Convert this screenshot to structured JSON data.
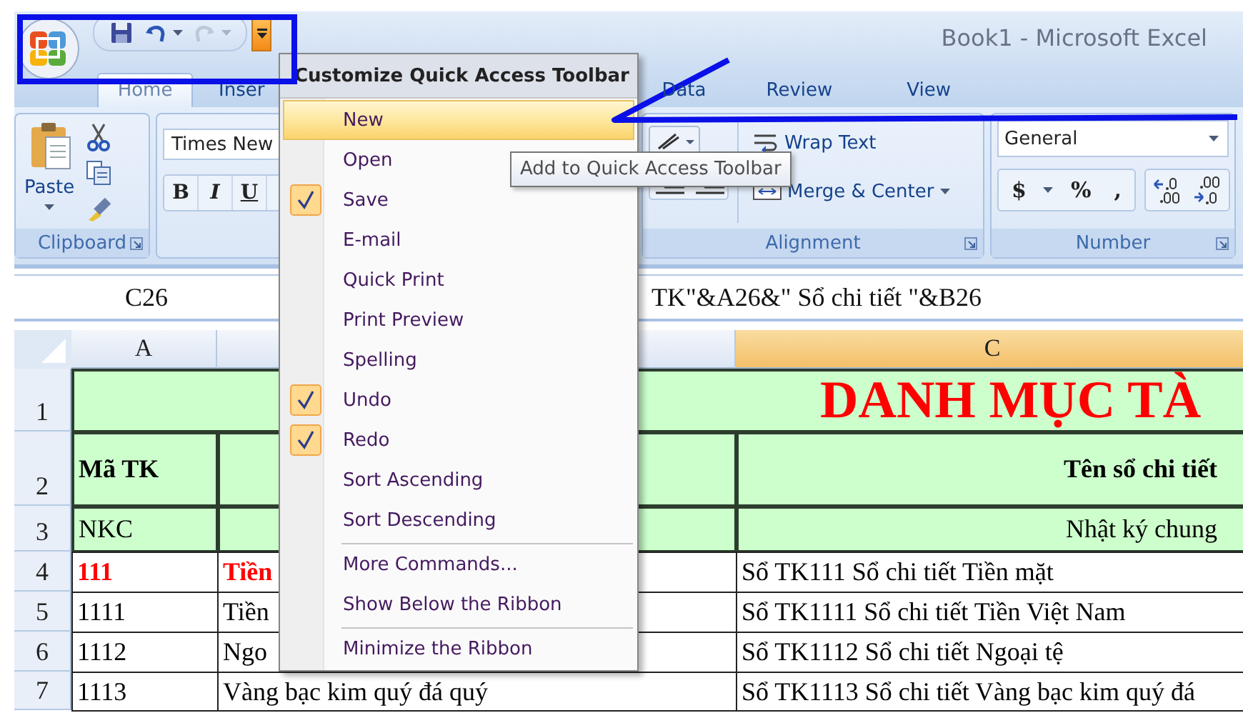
{
  "window": {
    "title": "Book1 - Microsoft Excel"
  },
  "quick_access": [
    {
      "kind": "save",
      "disabled": false
    },
    {
      "kind": "undo",
      "disabled": false
    },
    {
      "kind": "redo",
      "disabled": true
    }
  ],
  "tabs": [
    {
      "label": "Home",
      "selected": true
    },
    {
      "label": "Inser",
      "selected": false
    },
    {
      "label": "Data",
      "selected": false
    },
    {
      "label": "Review",
      "selected": false
    },
    {
      "label": "View",
      "selected": false
    }
  ],
  "ribbon": {
    "groups": [
      {
        "kind": "clipboard",
        "label": "Clipboard",
        "paste_label": "Paste"
      },
      {
        "kind": "font",
        "font_name": "Times New",
        "buttons": [
          "B",
          "I",
          "U"
        ]
      },
      {
        "kind": "alignment",
        "label": "Alignment",
        "wrap_label": "Wrap Text",
        "merge_label": "Merge & Center"
      },
      {
        "kind": "number",
        "label": "Number",
        "format": "General",
        "buttons": [
          "$",
          "%",
          ","
        ]
      }
    ]
  },
  "formula_bar": {
    "name_box": "C26",
    "formula": "TK\"&A26&\" Sổ chi tiết \"&B26"
  },
  "sheet": {
    "columns": [
      {
        "label": "A",
        "selected": false
      },
      {
        "selected": false
      },
      {
        "label": "C",
        "selected": true
      }
    ],
    "rows": [
      {
        "number": "1",
        "highlighted": true,
        "title": "DANH MỤC TÀ"
      },
      {
        "number": "2",
        "highlighted": true,
        "cells": [
          {
            "text": "Mã TK",
            "bold": true,
            "color": "#000000"
          },
          {},
          {
            "text": "Tên sổ chi tiết",
            "bold": true,
            "color": "#000000"
          }
        ]
      },
      {
        "number": "3",
        "highlighted": true,
        "cells": [
          {
            "text": "NKC",
            "bold": false,
            "color": "#000000"
          },
          {},
          {
            "text": "Nhật ký chung",
            "bold": false,
            "color": "#000000"
          }
        ]
      },
      {
        "number": "4",
        "highlighted": false,
        "cells": [
          {
            "text": "111",
            "bold": true,
            "color": "#ff0000"
          },
          {
            "text": "Tiền",
            "bold": true,
            "color": "#ff0000"
          },
          {
            "text": "Sổ TK111 Sổ chi tiết Tiền mặt",
            "bold": false,
            "color": "#000000"
          }
        ]
      },
      {
        "number": "5",
        "highlighted": false,
        "cells": [
          {
            "text": "1111",
            "bold": false,
            "color": "#000000"
          },
          {
            "text": "Tiền",
            "bold": false,
            "color": "#000000"
          },
          {
            "text": "Sổ TK1111 Sổ chi tiết Tiền Việt Nam",
            "bold": false,
            "color": "#000000"
          }
        ]
      },
      {
        "number": "6",
        "highlighted": false,
        "cells": [
          {
            "text": "1112",
            "bold": false,
            "color": "#000000"
          },
          {
            "text": "Ngo",
            "bold": false,
            "color": "#000000"
          },
          {
            "text": "Sổ TK1112 Sổ chi tiết Ngoại tệ",
            "bold": false,
            "color": "#000000"
          }
        ]
      },
      {
        "number": "7",
        "highlighted": false,
        "cells": [
          {
            "text": "1113",
            "bold": false,
            "color": "#000000"
          },
          {
            "text": "Vàng bạc kim quý đá quý",
            "bold": false,
            "color": "#000000"
          },
          {
            "text": "Sổ TK1113 Sổ chi tiết Vàng bạc kim quý đá",
            "bold": false,
            "color": "#000000"
          }
        ]
      }
    ]
  },
  "menu": {
    "title": "Customize Quick Access Toolbar",
    "items": [
      {
        "label": "New",
        "checked": false,
        "selected": true
      },
      {
        "label": "Open",
        "checked": false,
        "selected": false
      },
      {
        "label": "Save",
        "checked": true,
        "selected": false
      },
      {
        "label": "E-mail",
        "checked": false,
        "selected": false
      },
      {
        "label": "Quick Print",
        "checked": false,
        "selected": false
      },
      {
        "label": "Print Preview",
        "checked": false,
        "selected": false
      },
      {
        "label": "Spelling",
        "checked": false,
        "selected": false
      },
      {
        "label": "Undo",
        "checked": true,
        "selected": false
      },
      {
        "label": "Redo",
        "checked": true,
        "selected": false
      },
      {
        "label": "Sort Ascending",
        "checked": false,
        "selected": false
      },
      {
        "label": "Sort Descending",
        "checked": false,
        "selected": false
      },
      {
        "label": "More Commands...",
        "checked": false,
        "selected": false,
        "group_start": true
      },
      {
        "label": "Show Below the Ribbon",
        "checked": false,
        "selected": false
      },
      {
        "label": "Minimize the Ribbon",
        "checked": false,
        "selected": false,
        "group_start": true
      }
    ]
  },
  "tooltip": {
    "text": "Add to Quick Access Toolbar"
  }
}
